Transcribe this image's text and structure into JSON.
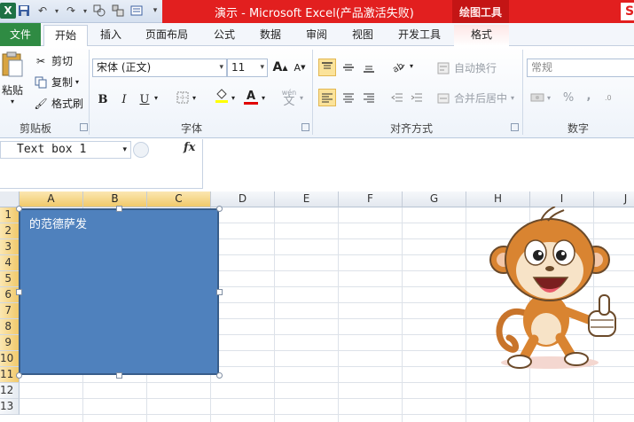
{
  "window": {
    "title": "演示 - Microsoft Excel(产品激活失败)",
    "tool_context_title": "绘图工具"
  },
  "tabs": [
    {
      "label": "文件"
    },
    {
      "label": "开始"
    },
    {
      "label": "插入"
    },
    {
      "label": "页面布局"
    },
    {
      "label": "公式"
    },
    {
      "label": "数据"
    },
    {
      "label": "审阅"
    },
    {
      "label": "视图"
    },
    {
      "label": "开发工具"
    },
    {
      "label": "格式"
    }
  ],
  "ribbon": {
    "clipboard": {
      "paste_label": "粘贴",
      "cut_label": "剪切",
      "copy_label": "复制",
      "format_painter_label": "格式刷",
      "group_label": "剪贴板"
    },
    "font": {
      "font_name": "宋体 (正文)",
      "font_size": "11",
      "bold": "B",
      "italic": "I",
      "underline": "U",
      "grow": "A",
      "shrink": "A",
      "font_color_letter": "A",
      "phonetic": "wén",
      "group_label": "字体"
    },
    "alignment": {
      "wrap_label": "自动换行",
      "merge_label": "合并后居中",
      "group_label": "对齐方式"
    },
    "number": {
      "format": "常规",
      "percent": "%",
      "comma": ",",
      "group_label": "数字"
    }
  },
  "formula_bar": {
    "name_box": "Text box 1",
    "fx": "fx",
    "formula": ""
  },
  "sheet": {
    "columns": [
      "A",
      "B",
      "C",
      "D",
      "E",
      "F",
      "G",
      "H",
      "I",
      "J"
    ],
    "selected_columns": [
      "A",
      "B",
      "C"
    ],
    "rows": [
      "1",
      "2",
      "3",
      "4",
      "5",
      "6",
      "7",
      "8",
      "9",
      "10",
      "11",
      "12",
      "13"
    ],
    "selected_rows": [
      "1",
      "2",
      "3",
      "4",
      "5",
      "6",
      "7",
      "8",
      "9",
      "10",
      "11"
    ]
  },
  "text_box": {
    "text": "的范德萨发",
    "fill_color": "#4f81bd",
    "border_color": "#385d8a"
  },
  "picture": {
    "subject": "cartoon monkey giving thumbs up"
  },
  "colors": {
    "file_tab": "#2f8b43",
    "title_bar_red": "#e21f1f",
    "selection_header": "#f1c96a"
  }
}
